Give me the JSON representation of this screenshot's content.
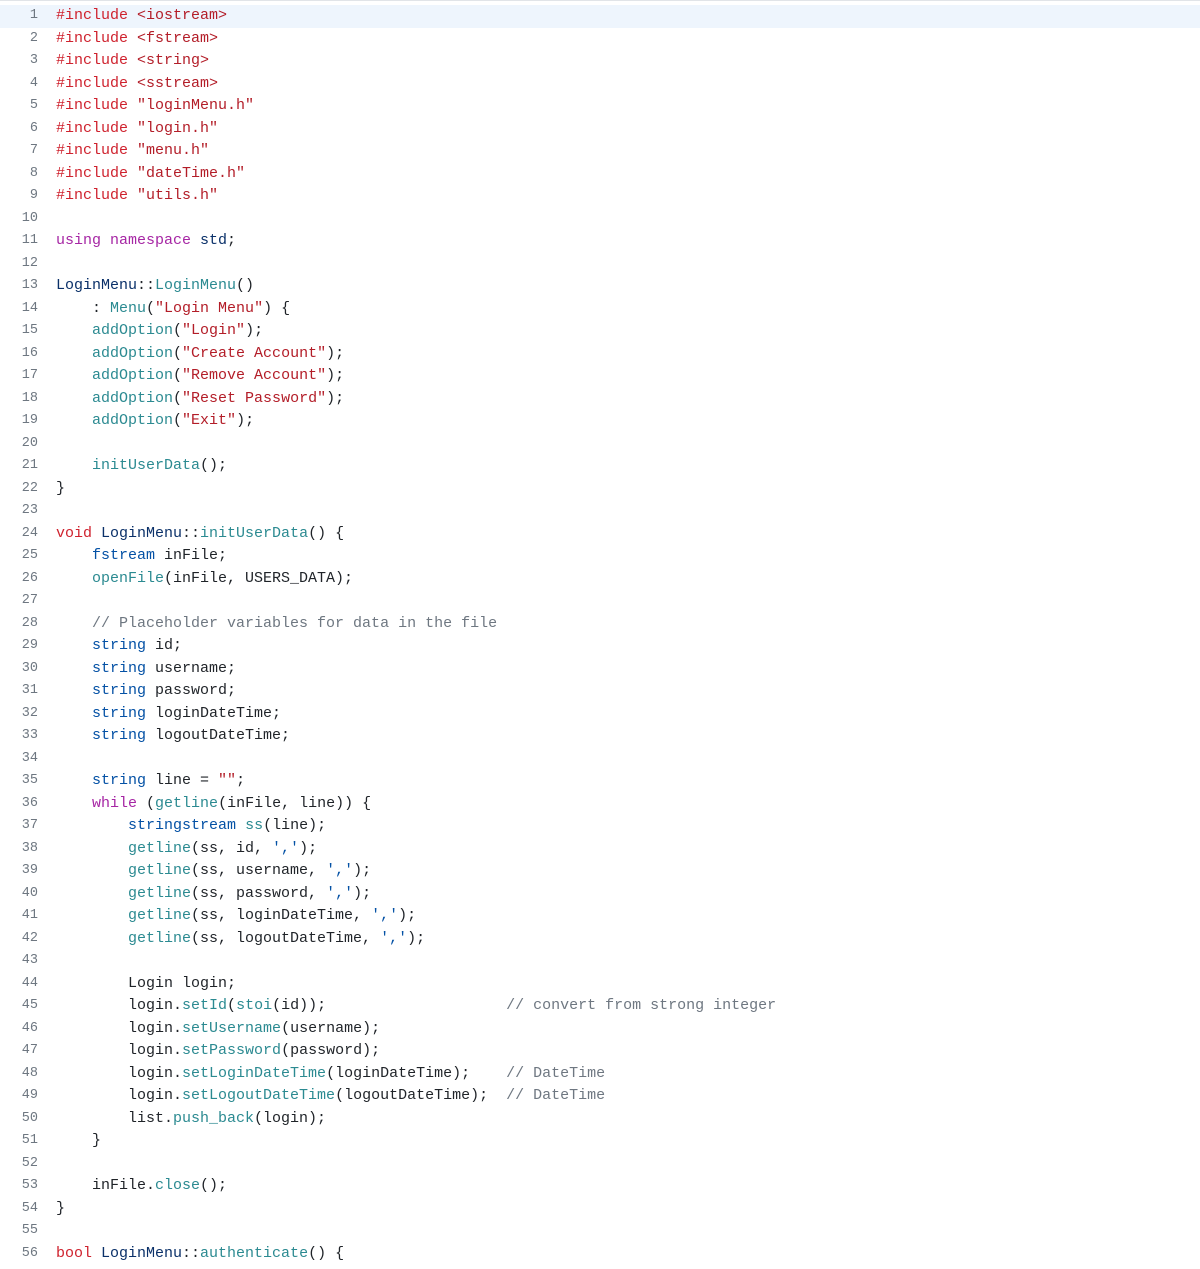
{
  "lines": {
    "l1": [
      [
        "kw-red",
        "#include "
      ],
      [
        "kw-dred",
        "<iostream>"
      ]
    ],
    "l2": [
      [
        "kw-red",
        "#include "
      ],
      [
        "kw-dred",
        "<fstream>"
      ]
    ],
    "l3": [
      [
        "kw-red",
        "#include "
      ],
      [
        "kw-dred",
        "<string>"
      ]
    ],
    "l4": [
      [
        "kw-red",
        "#include "
      ],
      [
        "kw-dred",
        "<sstream>"
      ]
    ],
    "l5": [
      [
        "kw-red",
        "#include "
      ],
      [
        "kw-dred",
        "\"loginMenu.h\""
      ]
    ],
    "l6": [
      [
        "kw-red",
        "#include "
      ],
      [
        "kw-dred",
        "\"login.h\""
      ]
    ],
    "l7": [
      [
        "kw-red",
        "#include "
      ],
      [
        "kw-dred",
        "\"menu.h\""
      ]
    ],
    "l8": [
      [
        "kw-red",
        "#include "
      ],
      [
        "kw-dred",
        "\"dateTime.h\""
      ]
    ],
    "l9": [
      [
        "kw-red",
        "#include "
      ],
      [
        "kw-dred",
        "\"utils.h\""
      ]
    ],
    "l10": [
      [
        "kw-plain",
        ""
      ]
    ],
    "l11": [
      [
        "kw-purple",
        "using "
      ],
      [
        "kw-purple",
        "namespace "
      ],
      [
        "kw-dblue",
        "std"
      ],
      [
        "kw-plain",
        ";"
      ]
    ],
    "l12": [
      [
        "kw-plain",
        ""
      ]
    ],
    "l13": [
      [
        "kw-scope",
        "LoginMenu"
      ],
      [
        "kw-plain",
        "::"
      ],
      [
        "kw-teal",
        "LoginMenu"
      ],
      [
        "kw-plain",
        "()"
      ]
    ],
    "l14": [
      [
        "kw-plain",
        "    : "
      ],
      [
        "kw-teal",
        "Menu"
      ],
      [
        "kw-plain",
        "("
      ],
      [
        "kw-dred",
        "\"Login Menu\""
      ],
      [
        "kw-plain",
        ") {"
      ]
    ],
    "l15": [
      [
        "kw-plain",
        "    "
      ],
      [
        "kw-teal",
        "addOption"
      ],
      [
        "kw-plain",
        "("
      ],
      [
        "kw-dred",
        "\"Login\""
      ],
      [
        "kw-plain",
        ");"
      ]
    ],
    "l16": [
      [
        "kw-plain",
        "    "
      ],
      [
        "kw-teal",
        "addOption"
      ],
      [
        "kw-plain",
        "("
      ],
      [
        "kw-dred",
        "\"Create Account\""
      ],
      [
        "kw-plain",
        ");"
      ]
    ],
    "l17": [
      [
        "kw-plain",
        "    "
      ],
      [
        "kw-teal",
        "addOption"
      ],
      [
        "kw-plain",
        "("
      ],
      [
        "kw-dred",
        "\"Remove Account\""
      ],
      [
        "kw-plain",
        ");"
      ]
    ],
    "l18": [
      [
        "kw-plain",
        "    "
      ],
      [
        "kw-teal",
        "addOption"
      ],
      [
        "kw-plain",
        "("
      ],
      [
        "kw-dred",
        "\"Reset Password\""
      ],
      [
        "kw-plain",
        ");"
      ]
    ],
    "l19": [
      [
        "kw-plain",
        "    "
      ],
      [
        "kw-teal",
        "addOption"
      ],
      [
        "kw-plain",
        "("
      ],
      [
        "kw-dred",
        "\"Exit\""
      ],
      [
        "kw-plain",
        ");"
      ]
    ],
    "l20": [
      [
        "kw-plain",
        ""
      ]
    ],
    "l21": [
      [
        "kw-plain",
        "    "
      ],
      [
        "kw-teal",
        "initUserData"
      ],
      [
        "kw-plain",
        "();"
      ]
    ],
    "l22": [
      [
        "kw-plain",
        "}"
      ]
    ],
    "l23": [
      [
        "kw-plain",
        ""
      ]
    ],
    "l24": [
      [
        "kw-red",
        "void "
      ],
      [
        "kw-scope",
        "LoginMenu"
      ],
      [
        "kw-plain",
        "::"
      ],
      [
        "kw-teal",
        "initUserData"
      ],
      [
        "kw-plain",
        "() {"
      ]
    ],
    "l25": [
      [
        "kw-plain",
        "    "
      ],
      [
        "kw-blue",
        "fstream"
      ],
      [
        "kw-plain",
        " inFile;"
      ]
    ],
    "l26": [
      [
        "kw-plain",
        "    "
      ],
      [
        "kw-teal",
        "openFile"
      ],
      [
        "kw-plain",
        "(inFile, USERS_DATA);"
      ]
    ],
    "l27": [
      [
        "kw-plain",
        ""
      ]
    ],
    "l28": [
      [
        "kw-plain",
        "    "
      ],
      [
        "kw-gray",
        "// Placeholder variables for data in the file"
      ]
    ],
    "l29": [
      [
        "kw-plain",
        "    "
      ],
      [
        "kw-blue",
        "string"
      ],
      [
        "kw-plain",
        " id;"
      ]
    ],
    "l30": [
      [
        "kw-plain",
        "    "
      ],
      [
        "kw-blue",
        "string"
      ],
      [
        "kw-plain",
        " username;"
      ]
    ],
    "l31": [
      [
        "kw-plain",
        "    "
      ],
      [
        "kw-blue",
        "string"
      ],
      [
        "kw-plain",
        " password;"
      ]
    ],
    "l32": [
      [
        "kw-plain",
        "    "
      ],
      [
        "kw-blue",
        "string"
      ],
      [
        "kw-plain",
        " loginDateTime;"
      ]
    ],
    "l33": [
      [
        "kw-plain",
        "    "
      ],
      [
        "kw-blue",
        "string"
      ],
      [
        "kw-plain",
        " logoutDateTime;"
      ]
    ],
    "l34": [
      [
        "kw-plain",
        ""
      ]
    ],
    "l35": [
      [
        "kw-plain",
        "    "
      ],
      [
        "kw-blue",
        "string"
      ],
      [
        "kw-plain",
        " line = "
      ],
      [
        "kw-dred",
        "\"\""
      ],
      [
        "kw-plain",
        ";"
      ]
    ],
    "l36": [
      [
        "kw-plain",
        "    "
      ],
      [
        "kw-purple",
        "while"
      ],
      [
        "kw-plain",
        " ("
      ],
      [
        "kw-teal",
        "getline"
      ],
      [
        "kw-plain",
        "(inFile, line)) {"
      ]
    ],
    "l37": [
      [
        "kw-plain",
        "        "
      ],
      [
        "kw-blue",
        "stringstream"
      ],
      [
        "kw-plain",
        " "
      ],
      [
        "kw-teal",
        "ss"
      ],
      [
        "kw-plain",
        "(line);"
      ]
    ],
    "l38": [
      [
        "kw-plain",
        "        "
      ],
      [
        "kw-teal",
        "getline"
      ],
      [
        "kw-plain",
        "(ss, id, "
      ],
      [
        "kw-char",
        "','"
      ],
      [
        "kw-plain",
        ");"
      ]
    ],
    "l39": [
      [
        "kw-plain",
        "        "
      ],
      [
        "kw-teal",
        "getline"
      ],
      [
        "kw-plain",
        "(ss, username, "
      ],
      [
        "kw-char",
        "','"
      ],
      [
        "kw-plain",
        ");"
      ]
    ],
    "l40": [
      [
        "kw-plain",
        "        "
      ],
      [
        "kw-teal",
        "getline"
      ],
      [
        "kw-plain",
        "(ss, password, "
      ],
      [
        "kw-char",
        "','"
      ],
      [
        "kw-plain",
        ");"
      ]
    ],
    "l41": [
      [
        "kw-plain",
        "        "
      ],
      [
        "kw-teal",
        "getline"
      ],
      [
        "kw-plain",
        "(ss, loginDateTime, "
      ],
      [
        "kw-char",
        "','"
      ],
      [
        "kw-plain",
        ");"
      ]
    ],
    "l42": [
      [
        "kw-plain",
        "        "
      ],
      [
        "kw-teal",
        "getline"
      ],
      [
        "kw-plain",
        "(ss, logoutDateTime, "
      ],
      [
        "kw-char",
        "','"
      ],
      [
        "kw-plain",
        ");"
      ]
    ],
    "l43": [
      [
        "kw-plain",
        ""
      ]
    ],
    "l44": [
      [
        "kw-plain",
        "        Login login;"
      ]
    ],
    "l45": [
      [
        "kw-plain",
        "        login."
      ],
      [
        "kw-teal",
        "setId"
      ],
      [
        "kw-plain",
        "("
      ],
      [
        "kw-teal",
        "stoi"
      ],
      [
        "kw-plain",
        "(id));                    "
      ],
      [
        "kw-gray",
        "// convert from strong integer"
      ]
    ],
    "l46": [
      [
        "kw-plain",
        "        login."
      ],
      [
        "kw-teal",
        "setUsername"
      ],
      [
        "kw-plain",
        "(username);"
      ]
    ],
    "l47": [
      [
        "kw-plain",
        "        login."
      ],
      [
        "kw-teal",
        "setPassword"
      ],
      [
        "kw-plain",
        "(password);"
      ]
    ],
    "l48": [
      [
        "kw-plain",
        "        login."
      ],
      [
        "kw-teal",
        "setLoginDateTime"
      ],
      [
        "kw-plain",
        "(loginDateTime);    "
      ],
      [
        "kw-gray",
        "// DateTime"
      ]
    ],
    "l49": [
      [
        "kw-plain",
        "        login."
      ],
      [
        "kw-teal",
        "setLogoutDateTime"
      ],
      [
        "kw-plain",
        "(logoutDateTime);  "
      ],
      [
        "kw-gray",
        "// DateTime"
      ]
    ],
    "l50": [
      [
        "kw-plain",
        "        list."
      ],
      [
        "kw-teal",
        "push_back"
      ],
      [
        "kw-plain",
        "(login);"
      ]
    ],
    "l51": [
      [
        "kw-plain",
        "    }"
      ]
    ],
    "l52": [
      [
        "kw-plain",
        ""
      ]
    ],
    "l53": [
      [
        "kw-plain",
        "    inFile."
      ],
      [
        "kw-teal",
        "close"
      ],
      [
        "kw-plain",
        "();"
      ]
    ],
    "l54": [
      [
        "kw-plain",
        "}"
      ]
    ],
    "l55": [
      [
        "kw-plain",
        ""
      ]
    ],
    "l56": [
      [
        "kw-red",
        "bool "
      ],
      [
        "kw-scope",
        "LoginMenu"
      ],
      [
        "kw-plain",
        "::"
      ],
      [
        "kw-teal",
        "authenticate"
      ],
      [
        "kw-plain",
        "() {"
      ]
    ]
  },
  "highlight_line": 1,
  "line_count": 56
}
